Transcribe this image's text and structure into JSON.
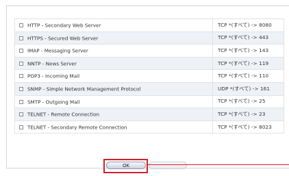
{
  "services": [
    {
      "name": "HTTP - Secondary Web Server",
      "protocol": "TCP *(すべて) -> 8080"
    },
    {
      "name": "HTTPS - Secured Web Server",
      "protocol": "TCP *(すべて) -> 443"
    },
    {
      "name": "IMAP - Messaging Server",
      "protocol": "TCP *(すべて) -> 143"
    },
    {
      "name": "NNTP - News Server",
      "protocol": "TCP *(すべて) -> 119"
    },
    {
      "name": "POP3 - Incoming Mail",
      "protocol": "TCP *(すべて) -> 110"
    },
    {
      "name": "SNMP - Simple Network Management Protocol",
      "protocol": "UDP *(すべて) -> 161"
    },
    {
      "name": "SMTP - Outgoing Mail",
      "protocol": "TCP *(すべて) -> 25"
    },
    {
      "name": "TELNET - Remote Connection",
      "protocol": "TCP *(すべて) -> 23"
    },
    {
      "name": "TELNET - Secondary Remote Connection",
      "protocol": "TCP *(すべて) -> 8023"
    }
  ],
  "buttons": {
    "ok_label": "OK"
  },
  "colors": {
    "highlight": "#d31f2b",
    "row_alt": "#eef1f6"
  }
}
